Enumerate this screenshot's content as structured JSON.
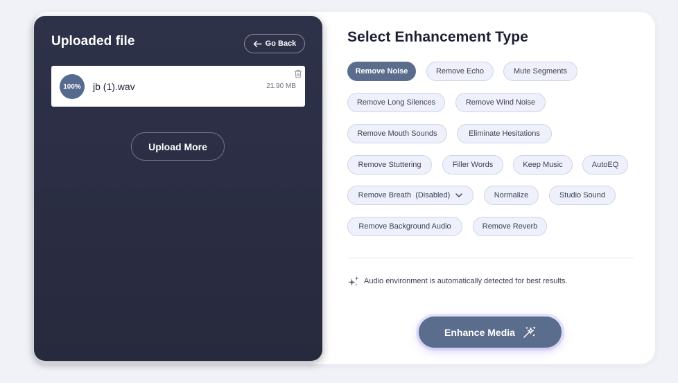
{
  "left_panel": {
    "title": "Uploaded file",
    "go_back_label": "Go Back",
    "file": {
      "progress": "100%",
      "name": "jb (1).wav",
      "size": "21.90 MB"
    },
    "upload_more_label": "Upload More"
  },
  "right_panel": {
    "title": "Select Enhancement Type",
    "options": [
      "Remove Noise",
      "Remove Echo",
      "Mute Segments",
      "Remove Long Silences",
      "Remove Wind Noise",
      "Remove Mouth Sounds",
      "Eliminate Hesitations",
      "Remove Stuttering",
      "Filler Words",
      "Keep Music",
      "AutoEQ",
      "Remove Breath  (Disabled)",
      "Normalize",
      "Studio Sound",
      "Remove Background Audio",
      "Remove Reverb"
    ],
    "selected_option": "Remove Noise",
    "info_text": "Audio environment is automatically detected for best results.",
    "enhance_label": "Enhance Media"
  },
  "colors": {
    "accent": "#5b6d8c",
    "dark_panel": "#2b2e44",
    "chip_bg": "#eef0fb",
    "chip_border": "#cfd3e6"
  },
  "icons": {
    "go_back": "arrow-left-icon",
    "delete": "trash-icon",
    "dropdown": "chevron-down-icon",
    "info": "sparkles-icon",
    "enhance": "magic-wand-icon"
  }
}
